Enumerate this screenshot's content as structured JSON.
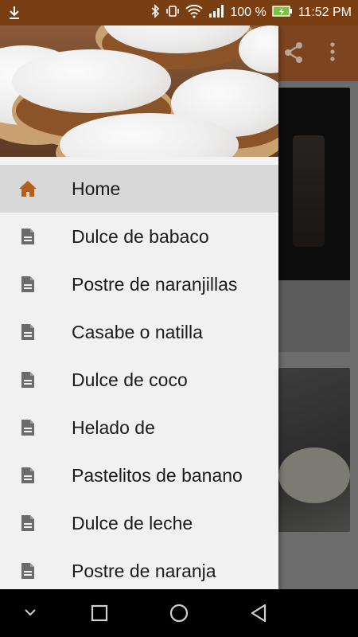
{
  "status_bar": {
    "battery_percent": "100 %",
    "time": "11:52 PM",
    "icons": [
      "download-icon",
      "bluetooth-icon",
      "vibrate-icon",
      "wifi-icon",
      "signal-icon",
      "battery-icon"
    ]
  },
  "drawer": {
    "items": [
      {
        "label": "Home",
        "icon": "home-icon",
        "active": true
      },
      {
        "label": "Dulce de babaco",
        "icon": "document-icon"
      },
      {
        "label": "Postre de naranjillas",
        "icon": "document-icon"
      },
      {
        "label": "Casabe o natilla",
        "icon": "document-icon"
      },
      {
        "label": "Dulce de coco",
        "icon": "document-icon"
      },
      {
        "label": "Helado de",
        "icon": "document-icon"
      },
      {
        "label": "Pastelitos de banano",
        "icon": "document-icon"
      },
      {
        "label": "Dulce de leche",
        "icon": "document-icon"
      },
      {
        "label": "Postre de naranja",
        "icon": "document-icon"
      }
    ]
  },
  "colors": {
    "accent": "#b35f17",
    "status_bar": "#7a3e13",
    "drawer_bg": "#f1f1f1",
    "active_item_bg": "#d8d8d8"
  },
  "navigation_bar": {
    "buttons": [
      "collapse-icon",
      "recents-icon",
      "home-circle-icon",
      "back-icon"
    ]
  }
}
